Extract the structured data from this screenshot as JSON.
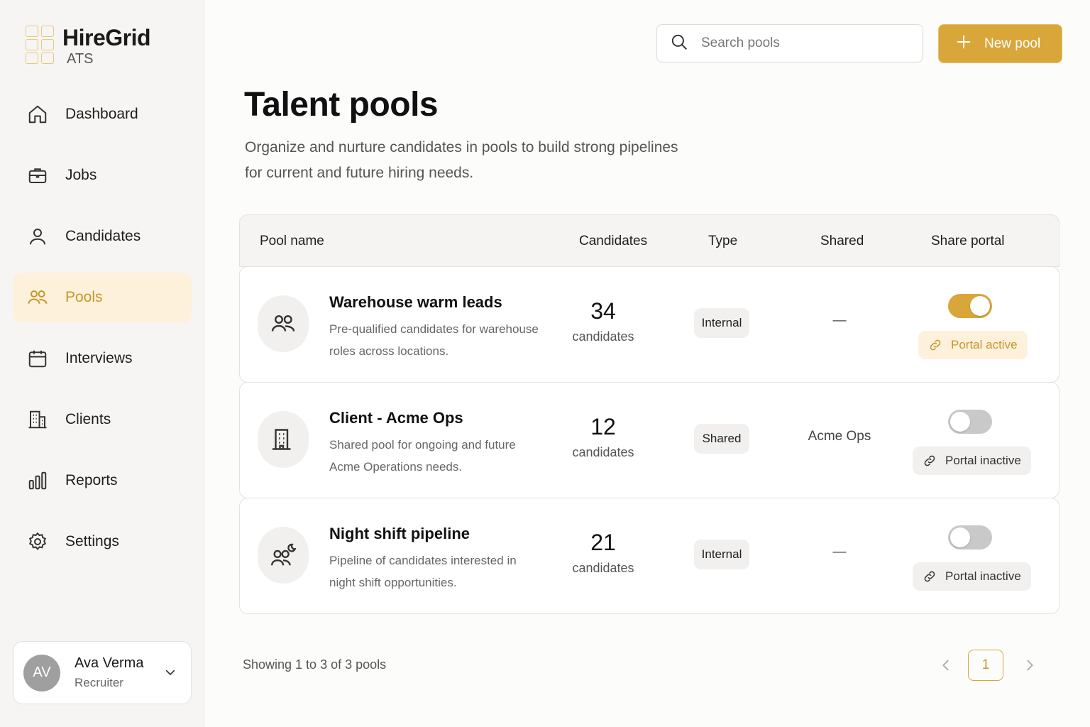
{
  "brand": {
    "name": "HireGrid",
    "sub": "ATS"
  },
  "nav": [
    {
      "label": "Dashboard",
      "icon": "home-icon",
      "active": false
    },
    {
      "label": "Jobs",
      "icon": "briefcase-icon",
      "active": false
    },
    {
      "label": "Candidates",
      "icon": "user-icon",
      "active": false
    },
    {
      "label": "Pools",
      "icon": "users-icon",
      "active": true
    },
    {
      "label": "Interviews",
      "icon": "calendar-icon",
      "active": false
    },
    {
      "label": "Clients",
      "icon": "building-icon",
      "active": false
    },
    {
      "label": "Reports",
      "icon": "bar-chart-icon",
      "active": false
    },
    {
      "label": "Settings",
      "icon": "gear-icon",
      "active": false
    }
  ],
  "user": {
    "initials": "AV",
    "name": "Ava Verma",
    "role": "Recruiter"
  },
  "search": {
    "placeholder": "Search pools"
  },
  "new_button": {
    "label": "New pool"
  },
  "page": {
    "title": "Talent pools",
    "description": "Organize and nurture candidates in pools to build strong pipelines for current and future hiring needs."
  },
  "table": {
    "headers": {
      "name": "Pool name",
      "candidates": "Candidates",
      "type": "Type",
      "shared": "Shared",
      "portal": "Share portal"
    },
    "rows": [
      {
        "name": "Warehouse warm leads",
        "description": "Pre-qualified candidates for warehouse roles across locations.",
        "count": "34",
        "count_label": "candidates",
        "type": "Internal",
        "shared": "—",
        "portal_on": true,
        "portal_status": "Portal active",
        "icon": "users-icon"
      },
      {
        "name": "Client - Acme Ops",
        "description": "Shared pool for ongoing and future Acme Operations needs.",
        "count": "12",
        "count_label": "candidates",
        "type": "Shared",
        "shared": "Acme Ops",
        "portal_on": false,
        "portal_status": "Portal inactive",
        "icon": "building-icon"
      },
      {
        "name": "Night shift pipeline",
        "description": "Pipeline of candidates interested in night shift opportunities.",
        "count": "21",
        "count_label": "candidates",
        "type": "Internal",
        "shared": "—",
        "portal_on": false,
        "portal_status": "Portal inactive",
        "icon": "moon-users-icon"
      }
    ]
  },
  "footer": {
    "showing": "Showing 1 to 3 of 3 pools",
    "current_page": "1"
  },
  "colors": {
    "accent": "#d9a63a",
    "accent_soft": "#fdf1dc"
  }
}
